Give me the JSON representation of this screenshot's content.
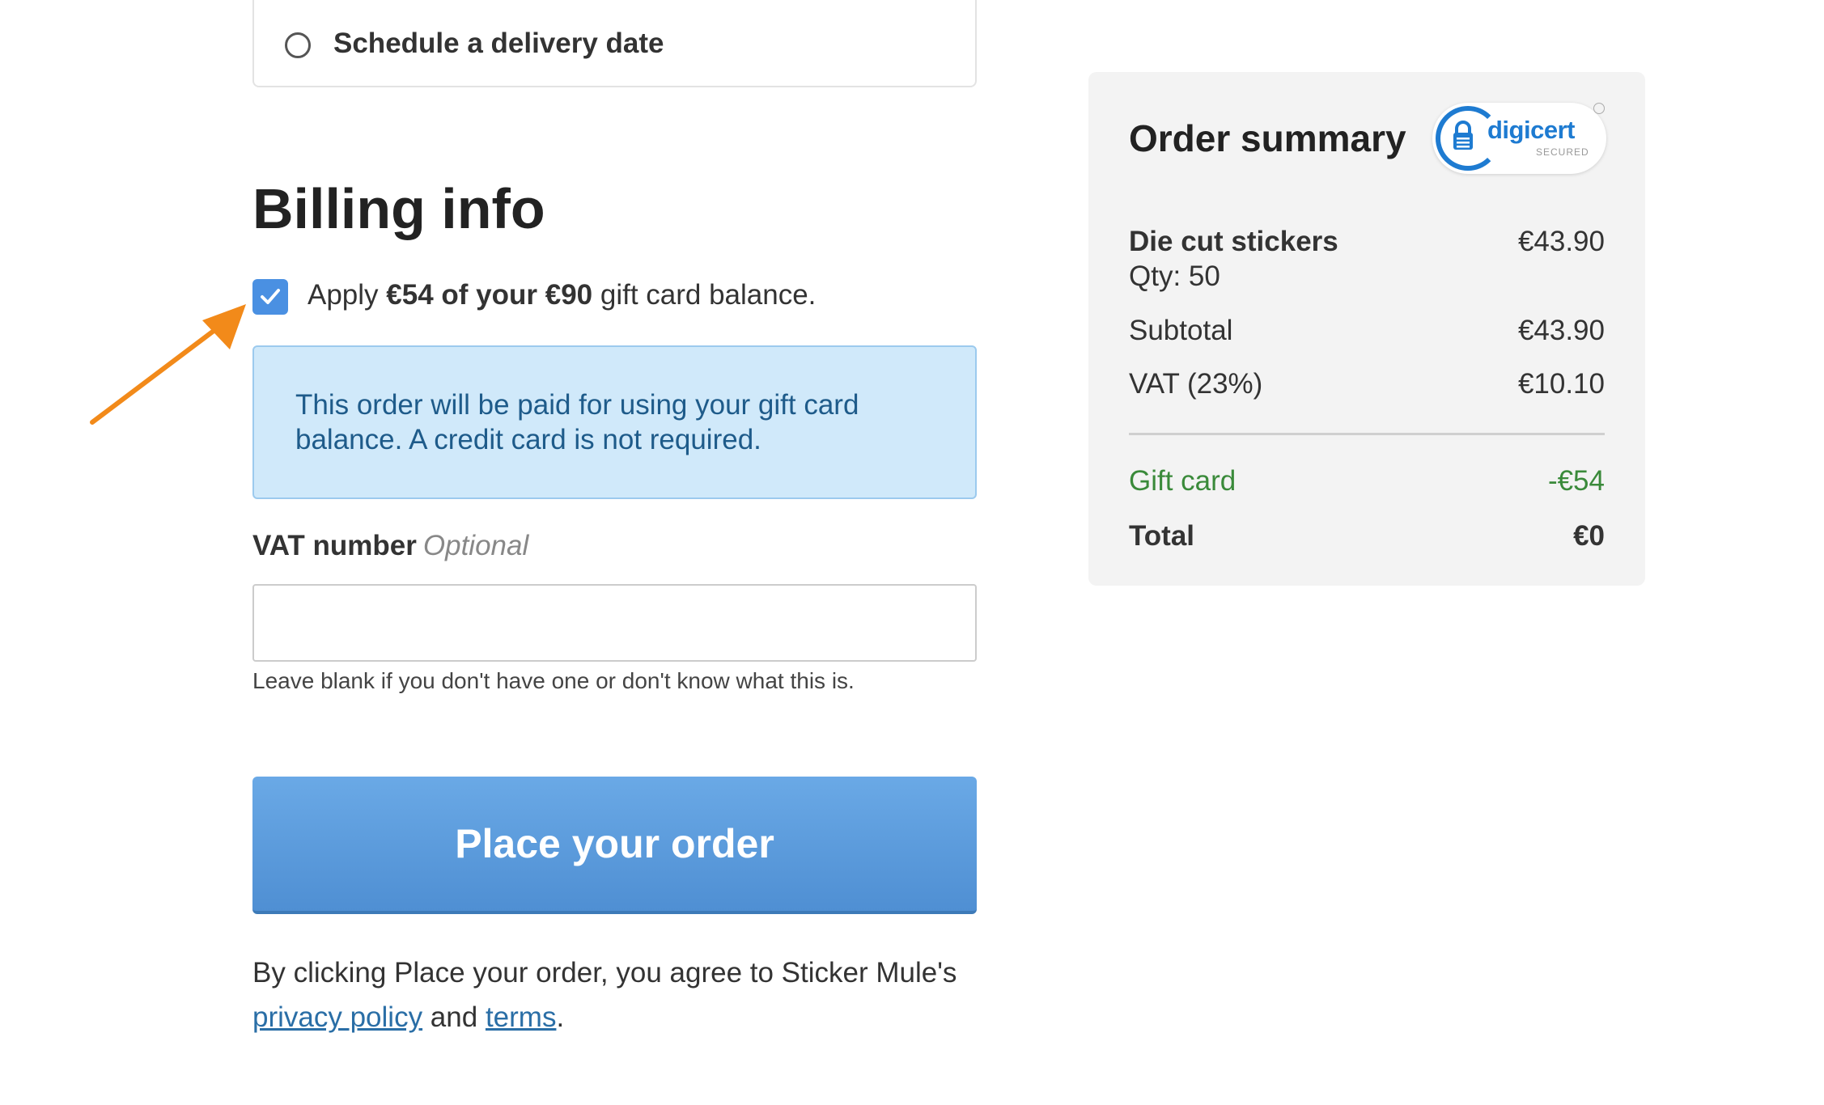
{
  "delivery": {
    "schedule_label": "Schedule a delivery date"
  },
  "billing": {
    "title": "Billing info",
    "gift_apply_prefix": "Apply ",
    "gift_apply_bold": "€54 of your €90",
    "gift_apply_suffix": " gift card balance.",
    "gift_checked": true,
    "info_message": "This order will be paid for using your gift card balance. A credit card is not required.",
    "vat_label": "VAT number",
    "vat_optional": "Optional",
    "vat_value": "",
    "vat_help": "Leave blank if you don't have one or don't know what this is.",
    "place_order_label": "Place your order",
    "agree_prefix": "By clicking Place your order, you agree to Sticker Mule's ",
    "privacy_link": "privacy policy",
    "agree_and": " and ",
    "terms_link": "terms",
    "agree_end": "."
  },
  "summary": {
    "title": "Order summary",
    "badge_brand": "digicert",
    "badge_sub": "SECURED",
    "item_name": "Die cut stickers",
    "item_price": "€43.90",
    "item_qty": "Qty: 50",
    "subtotal_label": "Subtotal",
    "subtotal_value": "€43.90",
    "vat_label": "VAT (23%)",
    "vat_value": "€10.10",
    "gift_label": "Gift card",
    "gift_value": "-€54",
    "total_label": "Total",
    "total_value": "€0"
  },
  "colors": {
    "accent": "#4a90e2",
    "info_bg": "#d0e9fa",
    "info_text": "#1e5b8a",
    "gift_green": "#3a8a3a",
    "annotation_arrow": "#f28a1a"
  }
}
